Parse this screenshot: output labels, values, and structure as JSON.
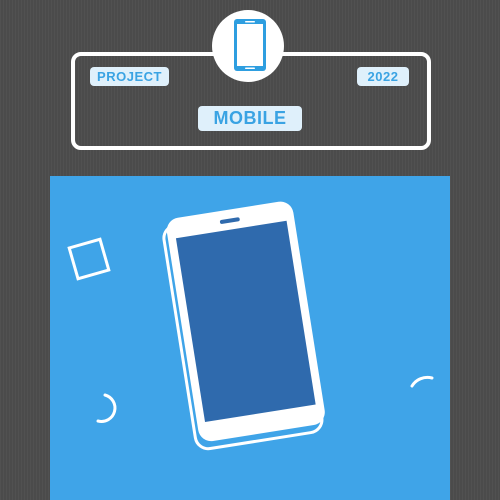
{
  "header": {
    "tag_left": "PROJECT",
    "tag_right": "2022",
    "title": "MOBILE"
  },
  "icons": {
    "badge": "smartphone-icon",
    "hero": "smartphone-illustration",
    "decorations": [
      "square-outline-shape",
      "arc-shape-left",
      "arc-shape-right"
    ]
  },
  "colors": {
    "background": "#4b4b4b",
    "panel": "#3fa4e8",
    "screen": "#2f6aad",
    "pill_fill": "#dff0fb",
    "pill_text": "#3aa3e3",
    "frame": "#ffffff"
  }
}
